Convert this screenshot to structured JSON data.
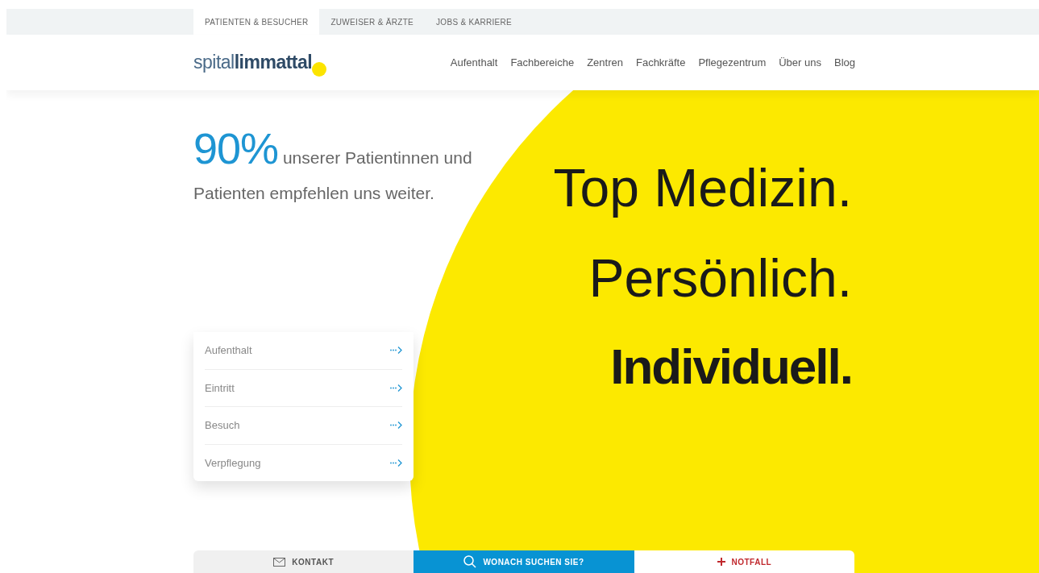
{
  "top_tabs": [
    {
      "label": "PATIENTEN & BESUCHER",
      "selected": true
    },
    {
      "label": "ZUWEISER & ÄRZTE",
      "selected": false
    },
    {
      "label": "JOBS & KARRIERE",
      "selected": false
    }
  ],
  "logo": {
    "light": "spital",
    "bold": "limmattal"
  },
  "nav": [
    "Aufenthalt",
    "Fachbereiche",
    "Zentren",
    "Fachkräfte",
    "Pflegezentrum",
    "Über uns",
    "Blog"
  ],
  "stat": {
    "value": "90%",
    "text": "unserer Patientinnen und Patienten empfehlen uns weiter."
  },
  "headline": [
    {
      "text": "Top Medizin.",
      "bold": false
    },
    {
      "text": "Persönlich.",
      "bold": false
    },
    {
      "text": "Individuell.",
      "bold": true
    }
  ],
  "quick_links": [
    "Aufenthalt",
    "Eintritt",
    "Besuch",
    "Verpflegung"
  ],
  "bottom_bar": [
    {
      "kind": "contact",
      "label": "KONTAKT"
    },
    {
      "kind": "search",
      "label": "WONACH SUCHEN SIE?"
    },
    {
      "kind": "emergency",
      "label": "NOTFALL"
    }
  ]
}
